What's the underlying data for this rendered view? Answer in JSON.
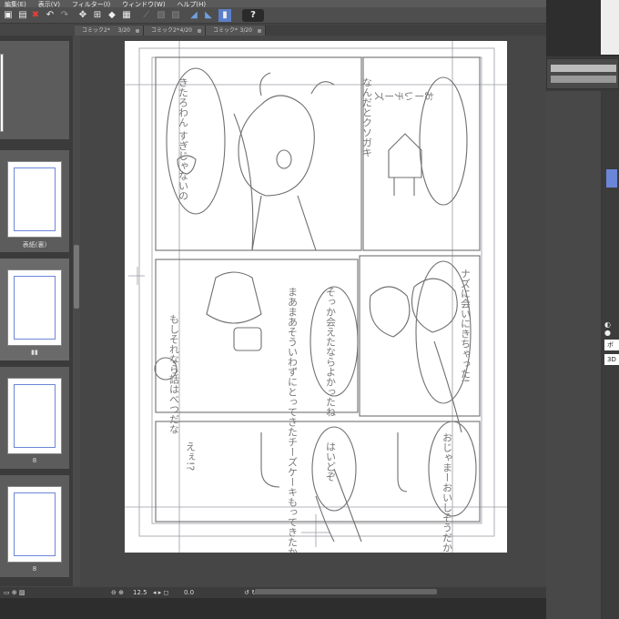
{
  "menu": {
    "items": [
      "編集(E)",
      "表示(V)",
      "フィルター(I)",
      "ウィンドウ(W)",
      "ヘルプ(H)"
    ]
  },
  "toolbar": {
    "help_label": "?"
  },
  "tabs": [
    {
      "name": "コミック2*",
      "page": "3/20"
    },
    {
      "name": "コミック2*",
      "page": "4/20"
    },
    {
      "name": "コミック*",
      "page": "3/20"
    }
  ],
  "pages": {
    "labels": [
      "表紙(裏)",
      "8",
      "8"
    ]
  },
  "manuscript": {
    "p1_right_speech": "なんだとクソガキ",
    "p1_left_speech": "きたろわん すぎじゃないの",
    "p1_mouse_speech": "おーいチーズ",
    "p2_right_speech": "ナズに会いにきちゃった!",
    "p2_mid_speech": "そっか会えたならよかったね",
    "p2_left_speech": "まあまあそういわずにとってきたチーズケーキもってきたからさ",
    "p2_far_left": "もしそれなら話はべつだな",
    "p3_right_speech": "おじゃまーおいしそうだかわいいね♡",
    "p3_mid_speech": "はいどぞ",
    "p3_left_speech": "えぇ!?"
  },
  "status": {
    "zoom": "12.5",
    "rotation": "0.0"
  },
  "right_panel": {
    "field1": "ボー",
    "field2": "3D"
  }
}
